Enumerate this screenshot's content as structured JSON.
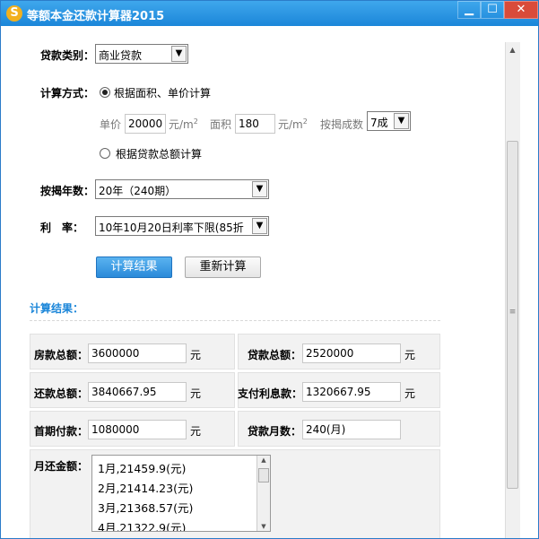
{
  "window": {
    "title": "等额本金还款计算器2015",
    "icon_glyph": "S",
    "min_glyph": "▁",
    "max_glyph": "☐",
    "close_glyph": "✕"
  },
  "form": {
    "loan_type_label": "贷款类别：",
    "loan_type_value": "商业贷款",
    "calc_method_label": "计算方式：",
    "option_area": "根据面积、单价计算",
    "unit_price_label": "单价",
    "unit_price_value": "20000",
    "unit_price_unit": "元/m",
    "unit_price_sup": "2",
    "area_label": "面积",
    "area_value": "180",
    "area_unit": "元/m",
    "area_sup": "2",
    "mortgage_ratio_label": "按揭成数",
    "mortgage_ratio_value": "7成",
    "option_total": "根据贷款总额计算",
    "years_label": "按揭年数：",
    "years_value": "20年（240期）",
    "rate_label": "利　率：",
    "rate_value": "10年10月20日利率下限(85折",
    "calc_button": "计算结果",
    "reset_button": "重新计算"
  },
  "results": {
    "title": "计算结果：",
    "house_total_label": "房款总额：",
    "house_total_value": "3600000",
    "house_total_unit": "元",
    "loan_total_label": "贷款总额：",
    "loan_total_value": "2520000",
    "loan_total_unit": "元",
    "repay_total_label": "还款总额：",
    "repay_total_value": "3840667.95",
    "repay_total_unit": "元",
    "interest_label": "支付利息款：",
    "interest_value": "1320667.95",
    "interest_unit": "元",
    "down_payment_label": "首期付款：",
    "down_payment_value": "1080000",
    "down_payment_unit": "元",
    "months_label": "贷款月数：",
    "months_value": "240(月)",
    "monthly_label": "月还金额：",
    "monthly_items": [
      "1月,21459.9(元)",
      "2月,21414.23(元)",
      "3月,21368.57(元)",
      "4月,21322.9(元)"
    ]
  },
  "icons": {
    "dropdown": "▼",
    "scroll_up": "▲",
    "scroll_down": "▼",
    "grip": "≡"
  }
}
